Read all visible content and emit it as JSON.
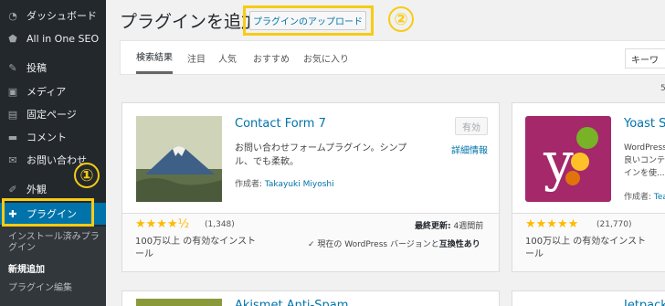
{
  "sidebar": {
    "items": [
      {
        "label": "ダッシュボード",
        "icon": "dashboard-icon"
      },
      {
        "label": "All in One SEO",
        "icon": "shield-icon"
      },
      {
        "label": "投稿",
        "icon": "pin-icon"
      },
      {
        "label": "メディア",
        "icon": "media-icon"
      },
      {
        "label": "固定ページ",
        "icon": "page-icon"
      },
      {
        "label": "コメント",
        "icon": "comment-icon"
      },
      {
        "label": "お問い合わせ",
        "icon": "mail-icon"
      },
      {
        "label": "外観",
        "icon": "brush-icon"
      },
      {
        "label": "プラグイン",
        "icon": "plugin-icon"
      }
    ],
    "submenu": [
      "インストール済みプラグイン",
      "新規追加",
      "プラグイン編集"
    ]
  },
  "annotations": {
    "one": "①",
    "two": "②",
    "color": "#f7cb15"
  },
  "header": {
    "title": "プラグインを追加",
    "upload_button": "プラグインのアップロード"
  },
  "tabs": [
    "検索結果",
    "注目",
    "人気",
    "おすすめ",
    "お気に入り"
  ],
  "search": {
    "select_value": "キーワ"
  },
  "results_count": "5",
  "cards": [
    {
      "name": "Contact Form 7",
      "description": "お問い合わせフォームプラグイン。シンプル、でも柔軟。",
      "author_label": "作成者: ",
      "author": "Takayuki Miyoshi",
      "status": "有効",
      "details": "詳細情報",
      "stars": "★★★★½",
      "rating_count": "(1,348)",
      "installs": "100万以上 の有効なインストール",
      "last_updated_label": "最終更新:",
      "last_updated": "4週間前",
      "compat_prefix": "✓ 現在の WordPress バージョンと",
      "compat_bold": "互換性あり"
    },
    {
      "name": "Yoast SE",
      "description": "WordPress 良いコンテ インを使...",
      "author_label": "作成者: ",
      "author": "Tea",
      "stars": "★★★★★",
      "rating_count": "(21,770)",
      "installs": "100万以上 の有効なインストール"
    }
  ],
  "bottom_cards": [
    "Akismet Anti-Spam",
    "Jetpack"
  ]
}
